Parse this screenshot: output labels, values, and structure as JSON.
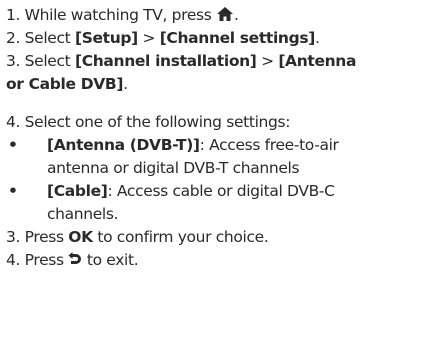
{
  "steps": {
    "s1": {
      "pre": "1. While watching TV, press ",
      "post": ".",
      "icon": "home-icon"
    },
    "s2": {
      "pre": "2. Select ",
      "a": "[Setup]",
      "sep": " > ",
      "b": "[Channel settings]",
      "post": "."
    },
    "s3": {
      "pre": "3. Select ",
      "a": "[Channel installation]",
      "sep": " > ",
      "b1": "[Antenna",
      "b2": "or Cable DVB]",
      "post": "."
    },
    "s4": {
      "text": "4. Select one of the following settings:"
    },
    "bullets": [
      {
        "dot": "•",
        "label": "[Antenna (DVB-T)]",
        "desc1": ": Access free-to-air",
        "desc2": "antenna or digital DVB-T channels"
      },
      {
        "dot": "•",
        "label": "[Cable]",
        "desc1": ": Access cable or digital DVB-C",
        "desc2": "channels."
      }
    ],
    "s5": {
      "pre": "3. Press ",
      "bold": "OK",
      "post": " to confirm your choice."
    },
    "s6": {
      "pre": "4. Press ",
      "post": " to exit.",
      "icon": "back-icon"
    }
  },
  "colors": {
    "text": "#2a2a2a"
  }
}
